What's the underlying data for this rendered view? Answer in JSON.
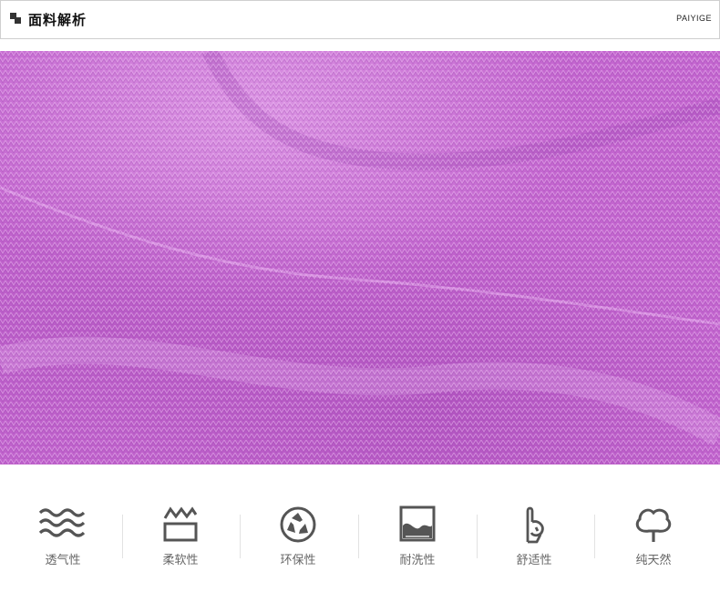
{
  "header": {
    "title": "面料解析",
    "brand": "PAIYIGE"
  },
  "fabric": {
    "base_color": "#c365cf",
    "light_color": "#e7aef0",
    "dark_color": "#a047b1"
  },
  "features": [
    {
      "label": "透气性",
      "icon": "waves-icon"
    },
    {
      "label": "柔软性",
      "icon": "soft-box-icon"
    },
    {
      "label": "环保性",
      "icon": "recycle-icon"
    },
    {
      "label": "耐洗性",
      "icon": "landscape-frame-icon"
    },
    {
      "label": "舒适性",
      "icon": "ok-hand-icon"
    },
    {
      "label": "纯天然",
      "icon": "tree-icon"
    }
  ],
  "icon_color": "#555555"
}
